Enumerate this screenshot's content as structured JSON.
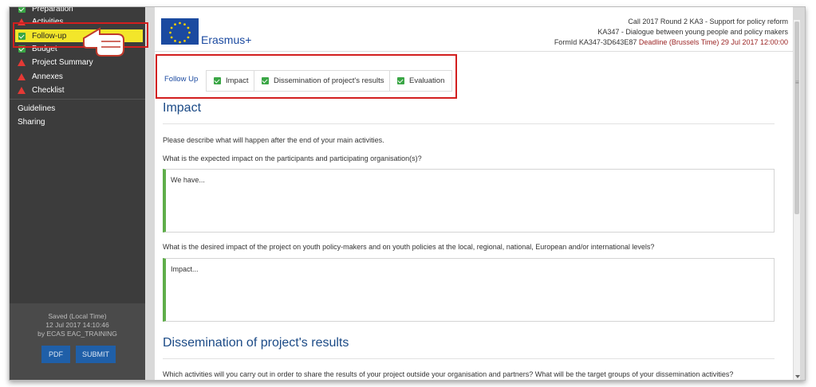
{
  "sidebar": {
    "items": [
      {
        "label": "Preparation",
        "status": "check"
      },
      {
        "label": "Activities",
        "status": "warning"
      },
      {
        "label": "Follow-up",
        "status": "check"
      },
      {
        "label": "Budget",
        "status": "check"
      },
      {
        "label": "Project Summary",
        "status": "warning"
      },
      {
        "label": "Annexes",
        "status": "warning"
      },
      {
        "label": "Checklist",
        "status": "warning"
      }
    ],
    "links": [
      "Guidelines",
      "Sharing"
    ],
    "saved": {
      "line1": "Saved (Local Time)",
      "line2": "12 Jul 2017 14:10:46",
      "line3": "by ECAS EAC_TRAINING"
    },
    "pdf_label": "PDF",
    "submit_label": "SUBMIT"
  },
  "header": {
    "brand": "Erasmus+",
    "call": "Call 2017  Round 2  KA3 - Support for policy reform",
    "action": "KA347 - Dialogue between young people and policy makers",
    "form_id": "FormId KA347-3D643E87",
    "deadline": "Deadline (Brussels Time) 29 Jul 2017 12:00:00"
  },
  "tabs": {
    "title": "Follow Up",
    "items": [
      "Impact",
      "Dissemination of project's results",
      "Evaluation"
    ]
  },
  "impact": {
    "heading": "Impact",
    "intro": "Please describe what will happen after the end of your main activities.",
    "q1": "What is the expected impact on the participants and participating organisation(s)?",
    "a1": "We have...",
    "q2": "What is the desired impact of the project on youth policy-makers and on youth policies at the local, regional, national, European and/or international levels?",
    "a2": "Impact..."
  },
  "dissemination": {
    "heading": "Dissemination of project's results",
    "q1": "Which activities will you carry out in order to share the results of your project outside your organisation and partners? What will be the target groups of your dissemination activities?"
  },
  "colors": {
    "accent": "#1b4aa0",
    "highlight": "#f3e62a",
    "alert": "#d21f1f",
    "ok": "#3aa645"
  }
}
